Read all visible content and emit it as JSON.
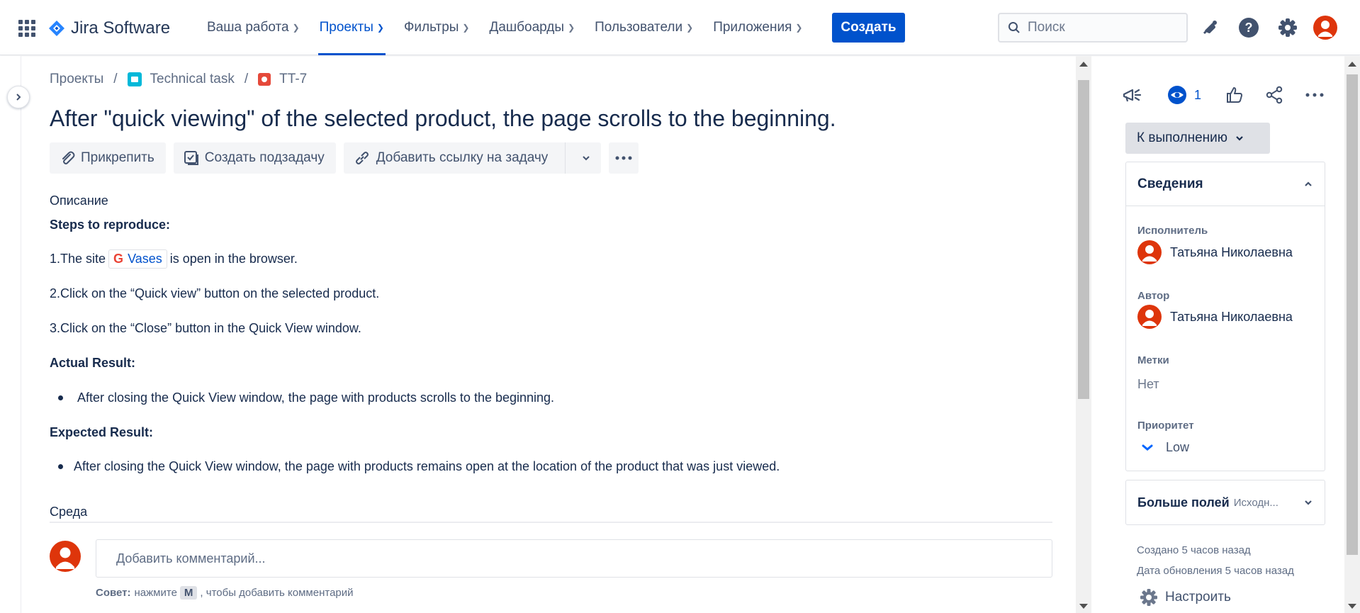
{
  "app": {
    "name": "Jira Software"
  },
  "nav": [
    {
      "label": "Ваша работа",
      "active": false
    },
    {
      "label": "Проекты",
      "active": true
    },
    {
      "label": "Фильтры",
      "active": false
    },
    {
      "label": "Дашбоарды",
      "active": false
    },
    {
      "label": "Пользователи",
      "active": false
    },
    {
      "label": "Приложения",
      "active": false
    }
  ],
  "create_label": "Создать",
  "search": {
    "placeholder": "Поиск"
  },
  "breadcrumb": {
    "root": "Проекты",
    "project": "Technical task",
    "issue_key": "TT-7"
  },
  "issue": {
    "title": "After \"quick viewing\" of the selected product, the page scrolls to the beginning.",
    "actions": {
      "attach": "Прикрепить",
      "subtask": "Создать подзадачу",
      "link": "Добавить ссылку на задачу"
    },
    "description_label": "Описание",
    "description": {
      "steps_heading": "Steps to reproduce:",
      "step1_prefix": "1.The site",
      "step1_link": "Vases",
      "step1_suffix": "is open in the browser.",
      "step2": "2.Click on the “Quick view” button on the selected product.",
      "step3": "3.Click on the “Close” button in the Quick View window.",
      "actual_heading": "Actual Result:",
      "actual_item": "After closing the Quick View window, the page with products scrolls to the beginning.",
      "expected_heading": "Expected Result:",
      "expected_item": "After closing the Quick View window, the page with products remains open at the location of the product that was just viewed."
    },
    "environment_label": "Среда"
  },
  "comment": {
    "placeholder": "Добавить комментарий...",
    "tip_bold": "Совет:",
    "tip_before": "нажмите",
    "tip_key": "M",
    "tip_after": ", чтобы добавить комментарий"
  },
  "sidebar": {
    "watch_count": "1",
    "status": "К выполнению",
    "details_title": "Сведения",
    "assignee_label": "Исполнитель",
    "assignee": "Татьяна Николаевна",
    "reporter_label": "Автор",
    "reporter": "Татьяна Николаевна",
    "labels_label": "Метки",
    "labels_value": "Нет",
    "priority_label": "Приоритет",
    "priority_value": "Low",
    "more_fields": "Больше полей",
    "more_fields_sub": "Исходн...",
    "created": "Создано 5 часов назад",
    "updated": "Дата обновления 5 часов назад",
    "configure": "Настроить"
  },
  "colors": {
    "brand": "#0052cc",
    "avatar": "#de350b",
    "bug": "#e5493a",
    "project": "#00b8d9"
  },
  "icons": [
    "app-switcher-icon",
    "jira-logo-icon",
    "search-icon",
    "notifications-icon",
    "help-icon",
    "settings-icon",
    "avatar",
    "paperclip-icon",
    "subtask-icon",
    "link-icon",
    "more-icon",
    "announcement-icon",
    "eye-icon",
    "thumbs-up-icon",
    "share-icon",
    "priority-low-icon",
    "gear-icon"
  ]
}
